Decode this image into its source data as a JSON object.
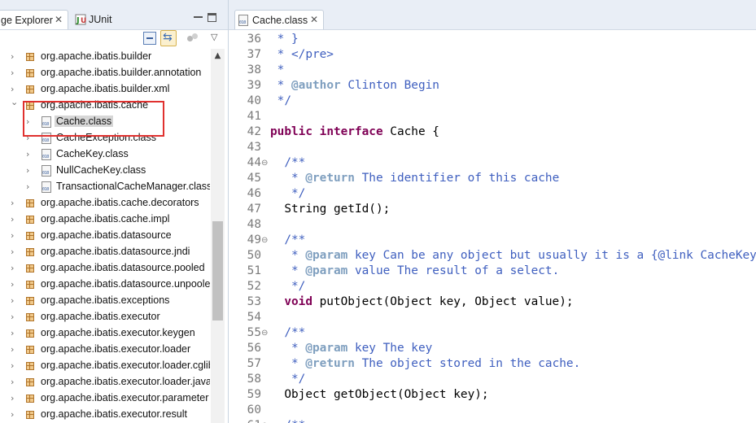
{
  "explorer": {
    "tab_label": "ge Explorer",
    "tab_close": "✕",
    "junit_tab_label": "JUnit",
    "tree": [
      {
        "label": "org.apache.ibatis.builder",
        "type": "package",
        "indent": 0,
        "chevron": "›"
      },
      {
        "label": "org.apache.ibatis.builder.annotation",
        "type": "package",
        "indent": 0,
        "chevron": "›"
      },
      {
        "label": "org.apache.ibatis.builder.xml",
        "type": "package",
        "indent": 0,
        "chevron": "›"
      },
      {
        "label": "org.apache.ibatis.cache",
        "type": "package",
        "indent": 0,
        "chevron": "⌄"
      },
      {
        "label": "Cache.class",
        "type": "class",
        "indent": 1,
        "chevron": "›",
        "selected": true
      },
      {
        "label": "CacheException.class",
        "type": "class",
        "indent": 1,
        "chevron": "›"
      },
      {
        "label": "CacheKey.class",
        "type": "class",
        "indent": 1,
        "chevron": "›"
      },
      {
        "label": "NullCacheKey.class",
        "type": "class",
        "indent": 1,
        "chevron": "›"
      },
      {
        "label": "TransactionalCacheManager.class",
        "type": "class",
        "indent": 1,
        "chevron": "›"
      },
      {
        "label": "org.apache.ibatis.cache.decorators",
        "type": "package",
        "indent": 0,
        "chevron": "›"
      },
      {
        "label": "org.apache.ibatis.cache.impl",
        "type": "package",
        "indent": 0,
        "chevron": "›"
      },
      {
        "label": "org.apache.ibatis.datasource",
        "type": "package",
        "indent": 0,
        "chevron": "›"
      },
      {
        "label": "org.apache.ibatis.datasource.jndi",
        "type": "package",
        "indent": 0,
        "chevron": "›"
      },
      {
        "label": "org.apache.ibatis.datasource.pooled",
        "type": "package",
        "indent": 0,
        "chevron": "›"
      },
      {
        "label": "org.apache.ibatis.datasource.unpooled",
        "type": "package",
        "indent": 0,
        "chevron": "›"
      },
      {
        "label": "org.apache.ibatis.exceptions",
        "type": "package",
        "indent": 0,
        "chevron": "›"
      },
      {
        "label": "org.apache.ibatis.executor",
        "type": "package",
        "indent": 0,
        "chevron": "›"
      },
      {
        "label": "org.apache.ibatis.executor.keygen",
        "type": "package",
        "indent": 0,
        "chevron": "›"
      },
      {
        "label": "org.apache.ibatis.executor.loader",
        "type": "package",
        "indent": 0,
        "chevron": "›"
      },
      {
        "label": "org.apache.ibatis.executor.loader.cglib",
        "type": "package",
        "indent": 0,
        "chevron": "›"
      },
      {
        "label": "org.apache.ibatis.executor.loader.javassist",
        "type": "package",
        "indent": 0,
        "chevron": "›"
      },
      {
        "label": "org.apache.ibatis.executor.parameter",
        "type": "package",
        "indent": 0,
        "chevron": "›"
      },
      {
        "label": "org.apache.ibatis.executor.result",
        "type": "package",
        "indent": 0,
        "chevron": "›"
      }
    ]
  },
  "editor": {
    "tab_label": "Cache.class",
    "tab_close": "✕",
    "lines": [
      {
        "n": "36",
        "fold": "",
        "segs": [
          {
            "t": " * }",
            "c": "c"
          }
        ]
      },
      {
        "n": "37",
        "fold": "",
        "segs": [
          {
            "t": " * </pre>",
            "c": "c"
          }
        ]
      },
      {
        "n": "38",
        "fold": "",
        "segs": [
          {
            "t": " *",
            "c": "c"
          }
        ]
      },
      {
        "n": "39",
        "fold": "",
        "segs": [
          {
            "t": " * ",
            "c": "c"
          },
          {
            "t": "@author",
            "c": "t"
          },
          {
            "t": " Clinton Begin",
            "c": "c"
          }
        ]
      },
      {
        "n": "40",
        "fold": "",
        "segs": [
          {
            "t": " */",
            "c": "c"
          }
        ]
      },
      {
        "n": "41",
        "fold": "",
        "segs": []
      },
      {
        "n": "42",
        "fold": "",
        "segs": [
          {
            "t": "public",
            "c": "k"
          },
          {
            "t": " ",
            "c": "p"
          },
          {
            "t": "interface",
            "c": "k"
          },
          {
            "t": " Cache {",
            "c": "p"
          }
        ]
      },
      {
        "n": "43",
        "fold": "",
        "segs": []
      },
      {
        "n": "44",
        "fold": "⊖",
        "segs": [
          {
            "t": "  /**",
            "c": "c"
          }
        ]
      },
      {
        "n": "45",
        "fold": "",
        "segs": [
          {
            "t": "   * ",
            "c": "c"
          },
          {
            "t": "@return",
            "c": "t"
          },
          {
            "t": " The identifier of this cache",
            "c": "c"
          }
        ]
      },
      {
        "n": "46",
        "fold": "",
        "segs": [
          {
            "t": "   */",
            "c": "c"
          }
        ]
      },
      {
        "n": "47",
        "fold": "",
        "segs": [
          {
            "t": "  String getId();",
            "c": "p"
          }
        ]
      },
      {
        "n": "48",
        "fold": "",
        "segs": []
      },
      {
        "n": "49",
        "fold": "⊖",
        "segs": [
          {
            "t": "  /**",
            "c": "c"
          }
        ]
      },
      {
        "n": "50",
        "fold": "",
        "segs": [
          {
            "t": "   * ",
            "c": "c"
          },
          {
            "t": "@param",
            "c": "t"
          },
          {
            "t": " key Can be any object but usually it is a {@link CacheKey}",
            "c": "c"
          }
        ]
      },
      {
        "n": "51",
        "fold": "",
        "segs": [
          {
            "t": "   * ",
            "c": "c"
          },
          {
            "t": "@param",
            "c": "t"
          },
          {
            "t": " value The result of a select.",
            "c": "c"
          }
        ]
      },
      {
        "n": "52",
        "fold": "",
        "segs": [
          {
            "t": "   */",
            "c": "c"
          }
        ]
      },
      {
        "n": "53",
        "fold": "",
        "segs": [
          {
            "t": "  ",
            "c": "p"
          },
          {
            "t": "void",
            "c": "k"
          },
          {
            "t": " putObject(Object key, Object value);",
            "c": "p"
          }
        ]
      },
      {
        "n": "54",
        "fold": "",
        "segs": []
      },
      {
        "n": "55",
        "fold": "⊖",
        "segs": [
          {
            "t": "  /**",
            "c": "c"
          }
        ]
      },
      {
        "n": "56",
        "fold": "",
        "segs": [
          {
            "t": "   * ",
            "c": "c"
          },
          {
            "t": "@param",
            "c": "t"
          },
          {
            "t": " key The key",
            "c": "c"
          }
        ]
      },
      {
        "n": "57",
        "fold": "",
        "segs": [
          {
            "t": "   * ",
            "c": "c"
          },
          {
            "t": "@return",
            "c": "t"
          },
          {
            "t": " The object stored in the cache.",
            "c": "c"
          }
        ]
      },
      {
        "n": "58",
        "fold": "",
        "segs": [
          {
            "t": "   */",
            "c": "c"
          }
        ]
      },
      {
        "n": "59",
        "fold": "",
        "segs": [
          {
            "t": "  Object getObject(Object key);",
            "c": "p"
          }
        ]
      },
      {
        "n": "60",
        "fold": "",
        "segs": []
      },
      {
        "n": "61",
        "fold": "⊖",
        "segs": [
          {
            "t": "  /**",
            "c": "c"
          }
        ]
      }
    ]
  },
  "colors": {
    "highlight_border": "#e0312f",
    "keyword": "#7f0055",
    "javadoc": "#3f5fbf",
    "javadoc_tag": "#7f9fbf"
  }
}
